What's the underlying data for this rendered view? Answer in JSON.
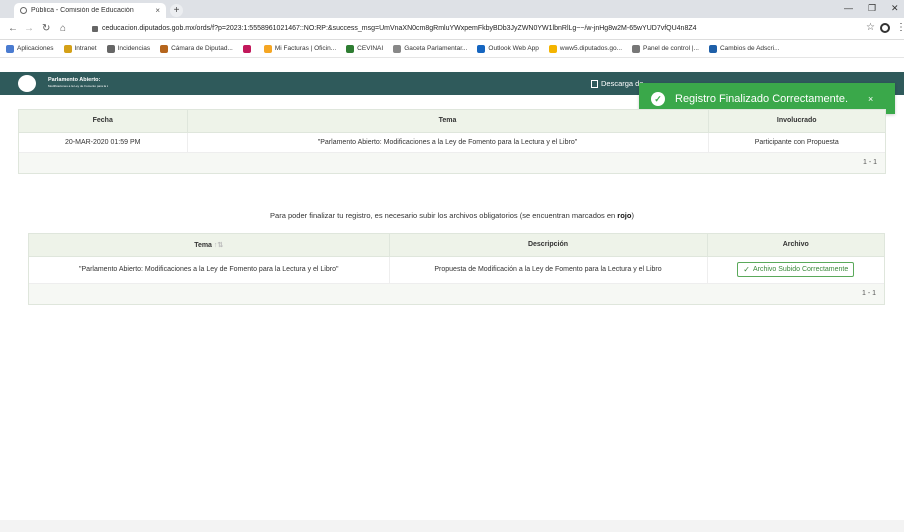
{
  "browser": {
    "tab_title": "Pública - Comisión de Educación",
    "tab_close": "×",
    "new_tab": "+",
    "url": "ceducacion.diputados.gob.mx/ords/f?p=2023:1:5558961021467::NO:RP:&success_msg=UmVnaXN0cm8gRmluYWxpemFkbyBDb3JyZWN0YW1lbnRlLg~~/w-jnHg8w2M-65wYUD7vfQU4n8Z4",
    "bookmarks": [
      {
        "label": "Aplicaciones",
        "color": "#4a7bd0"
      },
      {
        "label": "Intranet",
        "color": "#d4a017"
      },
      {
        "label": "Incidencias",
        "color": "#666666"
      },
      {
        "label": "Cámara de Diputad...",
        "color": "#b5651d"
      },
      {
        "label": "",
        "color": "#c2185b"
      },
      {
        "label": "Mi Facturas | Oficin...",
        "color": "#f5a623"
      },
      {
        "label": "CEVINAI",
        "color": "#2e7d32"
      },
      {
        "label": "Gaceta Parlamentar...",
        "color": "#888888"
      },
      {
        "label": "Outlook Web App",
        "color": "#1565c0"
      },
      {
        "label": "www5.diputados.go...",
        "color": "#f4b400"
      },
      {
        "label": "Panel de control |...",
        "color": "#777777"
      },
      {
        "label": "Cambios de Adscri...",
        "color": "#1e5fa8"
      }
    ]
  },
  "app": {
    "logo_title": "Parlamento Abierto:",
    "logo_subtitle": "Modificaciones a la Ley de Fomento para la Lectura y el Libro",
    "download_label": "Descarga de"
  },
  "toast": {
    "message": "Registro Finalizado Correctamente.",
    "close": "×",
    "icon": "check-circle-icon"
  },
  "registro_table": {
    "headers": [
      "Fecha",
      "Tema",
      "Involucrado"
    ],
    "row": [
      "20-MAR-2020 01:59 PM",
      "\"Parlamento Abierto: Modificaciones a la Ley de Fomento para la Lectura y el Libro\"",
      "Participante con Propuesta"
    ],
    "pager": "1 - 1"
  },
  "notice": {
    "text": "Para poder finalizar tu registro, es necesario subir los archivos obligatorios (se encuentran marcados en ",
    "emph": "rojo",
    "end": ")"
  },
  "archivos_table": {
    "headers": [
      "Tema",
      "Descripción",
      "Archivo"
    ],
    "sort_icon": "↑⇅",
    "row": [
      "\"Parlamento Abierto: Modificaciones a la Ley de Fomento para la Lectura y el Libro\"",
      "Propuesta de Modificación a la Ley de Fomento para la Lectura y el Libro"
    ],
    "button_label": "Archivo Subido Correctamente",
    "pager": "1 - 1"
  }
}
